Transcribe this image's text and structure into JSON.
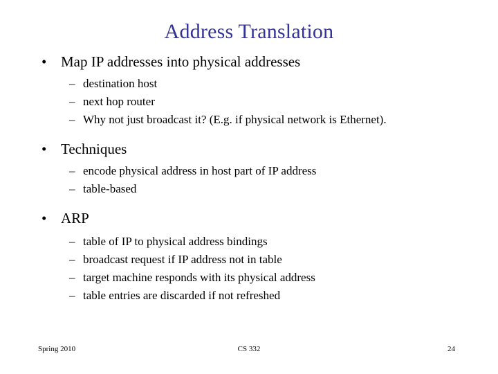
{
  "slide": {
    "title": "Address Translation",
    "title_color": "#333399",
    "text_color": "#000000",
    "background_color": "#ffffff",
    "bullet_glyph": "•",
    "dash_glyph": "–"
  },
  "content": {
    "sections": [
      {
        "heading": "Map IP addresses into physical addresses",
        "items": [
          "destination host",
          "next hop router",
          "Why not just broadcast it? (E.g. if physical network is Ethernet)."
        ]
      },
      {
        "heading": "Techniques",
        "items": [
          "encode physical address in host part of IP address",
          "table-based"
        ]
      },
      {
        "heading": "ARP",
        "items": [
          "table of IP to physical address bindings",
          "broadcast request if IP address not in table",
          "target machine responds with its physical address",
          "table entries are discarded if not refreshed"
        ]
      }
    ]
  },
  "footer": {
    "left": "Spring 2010",
    "center": "CS 332",
    "right": "24"
  }
}
